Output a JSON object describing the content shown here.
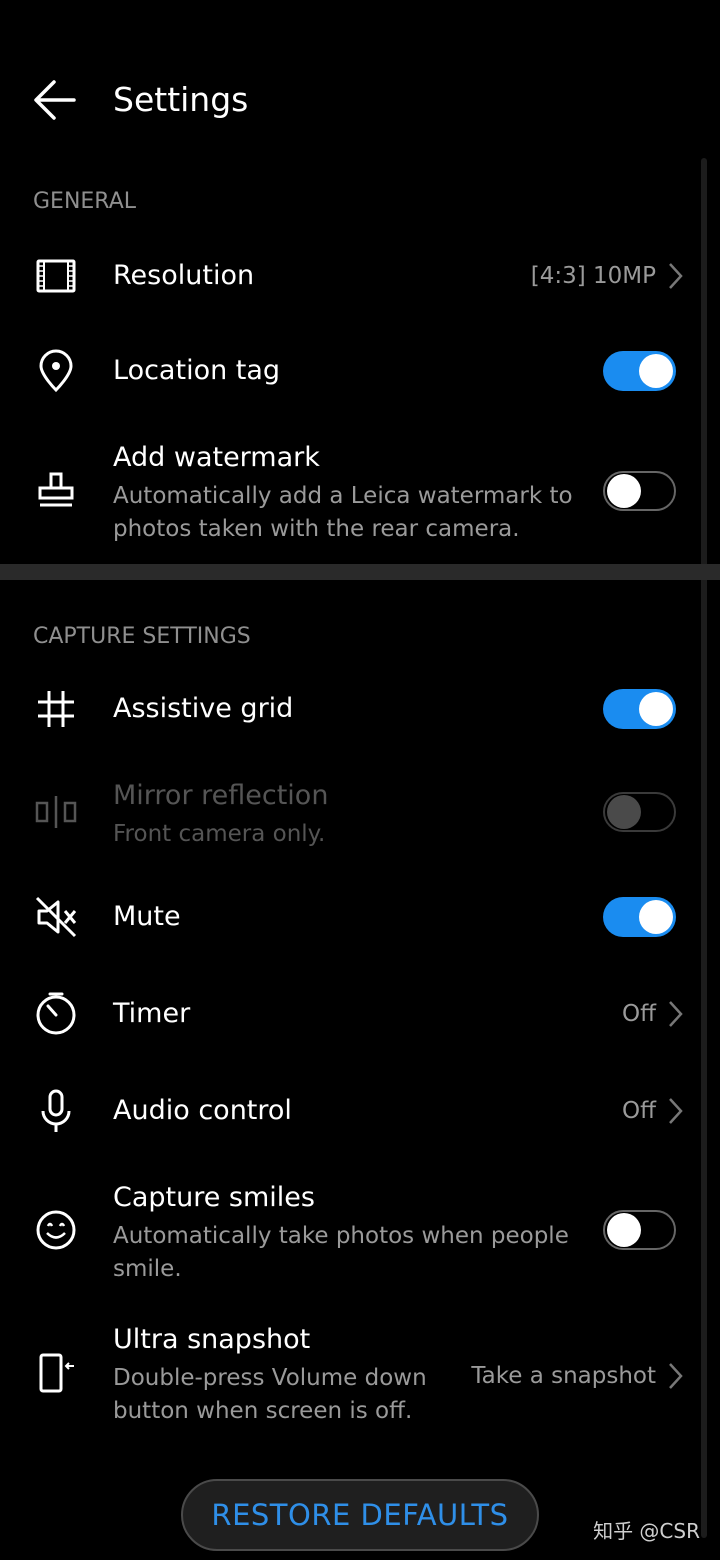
{
  "header": {
    "title": "Settings",
    "back_icon": "arrow-left-icon"
  },
  "sections": {
    "general": "GENERAL",
    "capture": "CAPTURE SETTINGS"
  },
  "rows": {
    "resolution": {
      "label": "Resolution",
      "value": "[4:3] 10MP",
      "icon": "resolution-frame-icon"
    },
    "location": {
      "label": "Location tag",
      "toggle": true,
      "icon": "location-pin-icon"
    },
    "watermark": {
      "label": "Add watermark",
      "desc": "Automatically add a Leica watermark to photos taken with the rear camera.",
      "toggle": false,
      "icon": "stamp-icon"
    },
    "grid": {
      "label": "Assistive grid",
      "toggle": true,
      "icon": "grid-icon"
    },
    "mirror": {
      "label": "Mirror reflection",
      "desc": "Front camera only.",
      "toggle": false,
      "disabled": true,
      "icon": "mirror-icon"
    },
    "mute": {
      "label": "Mute",
      "toggle": true,
      "icon": "speaker-mute-icon"
    },
    "timer": {
      "label": "Timer",
      "value": "Off",
      "icon": "timer-icon"
    },
    "audio": {
      "label": "Audio control",
      "value": "Off",
      "icon": "microphone-icon"
    },
    "smiles": {
      "label": "Capture smiles",
      "desc": "Automatically take photos when people smile.",
      "toggle": false,
      "icon": "smile-icon"
    },
    "snapshot": {
      "label": "Ultra snapshot",
      "desc": "Double-press Volume down button when screen is off.",
      "value": "Take a snapshot",
      "icon": "phone-snapshot-icon"
    }
  },
  "footer": {
    "restore_label": "RESTORE DEFAULTS",
    "watermark": "知乎 @CSR"
  },
  "colors": {
    "accent": "#1a8cf0",
    "button_text": "#2f8fe8",
    "background": "#000000"
  }
}
